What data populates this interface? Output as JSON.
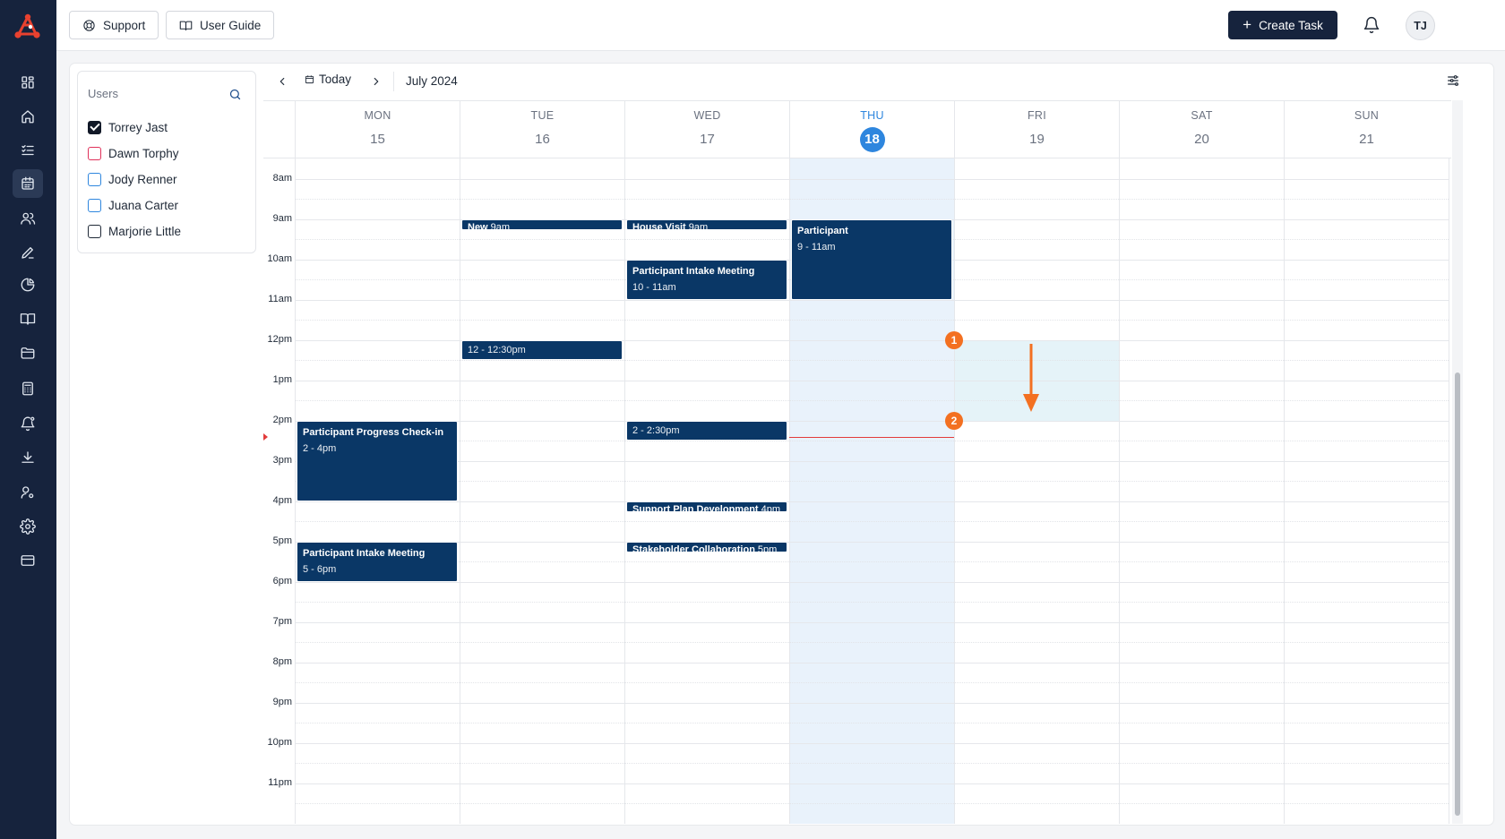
{
  "topbar": {
    "support_label": "Support",
    "guide_label": "User Guide",
    "create_label": "Create Task",
    "avatar_initials": "TJ"
  },
  "sidebar": {
    "items": [
      {
        "name": "dashboard-icon"
      },
      {
        "name": "home-icon"
      },
      {
        "name": "task-list-icon"
      },
      {
        "name": "calendar-icon",
        "active": true
      },
      {
        "name": "users-icon"
      },
      {
        "name": "edit-icon"
      },
      {
        "name": "pie-chart-icon"
      },
      {
        "name": "book-icon"
      },
      {
        "name": "folder-icon"
      },
      {
        "name": "calculator-icon"
      },
      {
        "name": "notification-settings-icon"
      },
      {
        "name": "download-icon"
      },
      {
        "name": "user-settings-icon"
      },
      {
        "name": "gear-icon"
      },
      {
        "name": "credit-card-icon"
      }
    ]
  },
  "users_panel": {
    "title": "Users",
    "users": [
      {
        "name": "Torrey Jast",
        "checked": true,
        "color": "#111827"
      },
      {
        "name": "Dawn Torphy",
        "checked": false,
        "color": "#e0315a"
      },
      {
        "name": "Jody Renner",
        "checked": false,
        "color": "#2e86de"
      },
      {
        "name": "Juana Carter",
        "checked": false,
        "color": "#2e86de"
      },
      {
        "name": "Marjorie Little",
        "checked": false,
        "color": "#1f2937"
      }
    ]
  },
  "calendar": {
    "today_label": "Today",
    "month_label": "July 2024",
    "days": [
      {
        "name": "MON",
        "num": "15"
      },
      {
        "name": "TUE",
        "num": "16"
      },
      {
        "name": "WED",
        "num": "17"
      },
      {
        "name": "THU",
        "num": "18",
        "today": true
      },
      {
        "name": "FRI",
        "num": "19"
      },
      {
        "name": "SAT",
        "num": "20"
      },
      {
        "name": "SUN",
        "num": "21"
      }
    ],
    "hours": [
      "8am",
      "9am",
      "10am",
      "11am",
      "12pm",
      "1pm",
      "2pm",
      "3pm",
      "4pm",
      "5pm",
      "6pm",
      "7pm",
      "8pm",
      "9pm",
      "10pm",
      "11pm"
    ],
    "first_hour": 7.5,
    "now_hour": 14.4,
    "selection": {
      "day": 4,
      "start": 12,
      "end": 14
    },
    "events": [
      {
        "day": 0,
        "start": 14,
        "end": 16,
        "title": "Participant Progress Check-in",
        "time": "2 - 4pm"
      },
      {
        "day": 0,
        "start": 17,
        "end": 18,
        "title": "Participant Intake Meeting",
        "time": "5 - 6pm"
      },
      {
        "day": 1,
        "start": 9,
        "end": 9.27,
        "title": "New",
        "time": "9am",
        "compact": true
      },
      {
        "day": 1,
        "start": 12,
        "end": 12.5,
        "title": "",
        "time": "12 - 12:30pm",
        "timeOnly": true
      },
      {
        "day": 2,
        "start": 9,
        "end": 9.27,
        "title": "House Visit",
        "time": "9am",
        "compact": true
      },
      {
        "day": 2,
        "start": 10,
        "end": 11,
        "title": "Participant Intake Meeting",
        "time": "10 - 11am"
      },
      {
        "day": 2,
        "start": 14,
        "end": 14.5,
        "title": "",
        "time": "2 - 2:30pm",
        "timeOnly": true
      },
      {
        "day": 2,
        "start": 16,
        "end": 16.27,
        "title": "Support Plan Development",
        "time": "4pm",
        "compact": true
      },
      {
        "day": 2,
        "start": 17,
        "end": 17.27,
        "title": "Stakeholder Collaboration",
        "time": "5pm",
        "compact": true
      },
      {
        "day": 3,
        "start": 9,
        "end": 11,
        "title": "Participant",
        "time": "9 - 11am"
      }
    ]
  },
  "annotation": {
    "badge_start": "1",
    "badge_end": "2",
    "color": "#f37021"
  }
}
